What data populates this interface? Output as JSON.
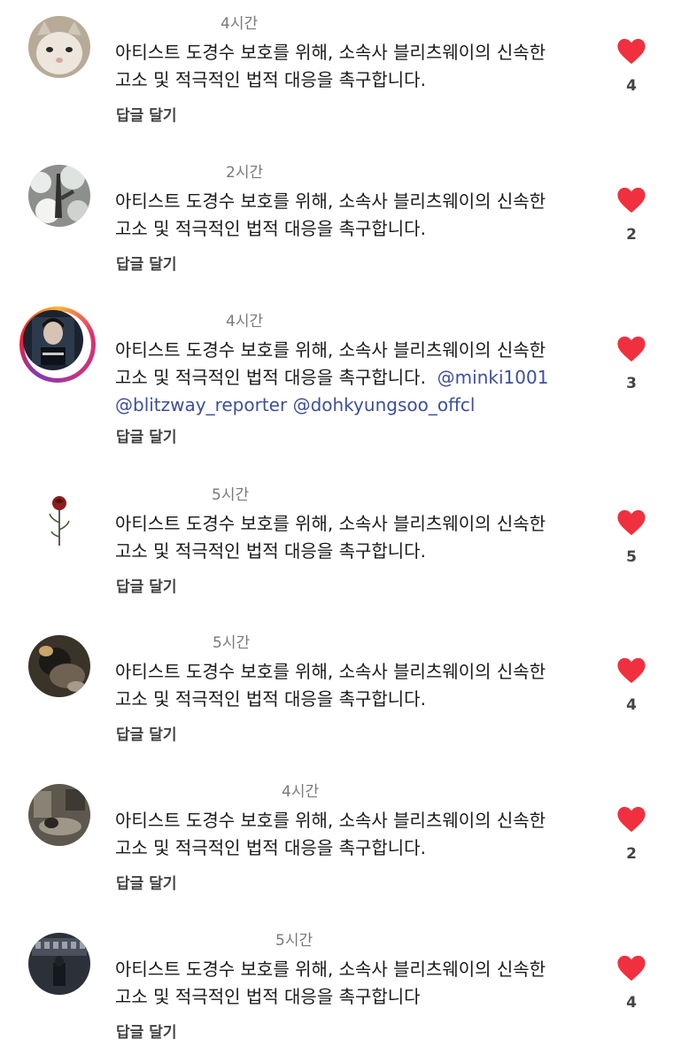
{
  "comments": [
    {
      "time": "4시간",
      "line1": "아티스트 도경수 보호를 위해, 소속사 블리츠웨이의 신속한",
      "line2": "고소 및 적극적인 법적 대응을 촉구합니다.",
      "reply": "답글 달기",
      "likes": "4",
      "avatar": "cat-photo"
    },
    {
      "time": "2시간",
      "line1": "아티스트 도경수 보호를 위해, 소속사 블리츠웨이의 신속한",
      "line2": "고소 및 적극적인 법적 대응을 촉구합니다.",
      "reply": "답글 달기",
      "likes": "2",
      "avatar": "snowy-trees-photo"
    },
    {
      "time": "4시간",
      "line1": "아티스트 도경수 보호를 위해, 소속사 블리츠웨이의 신속한",
      "line2": "고소 및 적극적인 법적 대응을 촉구합니다.",
      "mention1": "@minki1001",
      "mention2": "@blitzway_reporter",
      "mention3": "@dohkyungsoo_offcl",
      "reply": "답글 달기",
      "likes": "3",
      "avatar": "poster-photo-story-ring"
    },
    {
      "time": "5시간",
      "line1": "아티스트 도경수 보호를 위해, 소속사 블리츠웨이의 신속한",
      "line2": "고소 및 적극적인 법적 대응을 촉구합니다.",
      "reply": "답글 달기",
      "likes": "5",
      "avatar": "rose-drawing"
    },
    {
      "time": "5시간",
      "line1": "아티스트 도경수 보호를 위해, 소속사 블리츠웨이의 신속한",
      "line2": "고소 및 적극적인 법적 대응을 촉구합니다.",
      "reply": "답글 달기",
      "likes": "4",
      "avatar": "dark-photo"
    },
    {
      "time": "4시간",
      "line1": "아티스트 도경수 보호를 위해, 소속사 블리츠웨이의 신속한",
      "line2": "고소 및 적극적인 법적 대응을 촉구합니다.",
      "reply": "답글 달기",
      "likes": "2",
      "avatar": "room-photo"
    },
    {
      "time": "5시간",
      "line1": "아티스트 도경수 보호를 위해, 소속사 블리츠웨이의 신속한",
      "line2": "고소 및 적극적인 법적 대응을 촉구합니다",
      "reply": "답글 달기",
      "likes": "4",
      "avatar": "hall-photo"
    }
  ],
  "colors": {
    "heart": "#f0303f",
    "mention": "#3d4f9e",
    "meta": "#7a7a7a"
  }
}
